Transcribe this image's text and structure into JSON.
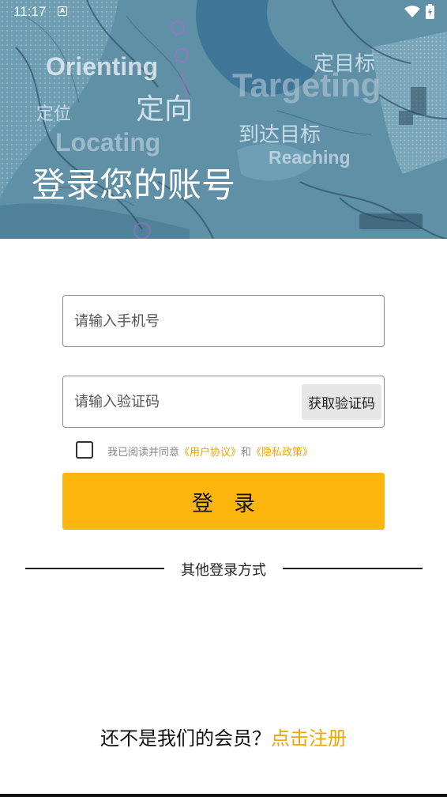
{
  "status_bar": {
    "time": "11:17",
    "notification_icon": "A"
  },
  "hero": {
    "slogans": {
      "orienting": "Orienting",
      "dingwei": "定位",
      "dingxiang": "定向",
      "locating": "Locating",
      "dingmubiao": "定目标",
      "targeting": "Targeting",
      "daoda": "到达目标",
      "reaching": "Reaching"
    },
    "title": "登录您的账号"
  },
  "form": {
    "phone_placeholder": "请输入手机号",
    "phone_value": "",
    "code_placeholder": "请输入验证码",
    "code_value": "",
    "get_code_label": "获取验证码",
    "agree": {
      "checked": false,
      "prefix": "我已阅读并同意",
      "user_agreement": "《用户协议》",
      "and": "和",
      "privacy_policy": "《隐私政策》"
    },
    "login_label": "登录"
  },
  "other_login": {
    "label": "其他登录方式"
  },
  "register": {
    "prompt": "还不是我们的会员？",
    "link": "点击注册"
  },
  "colors": {
    "accent": "#fdb60d",
    "link": "#f0a500",
    "hero_bg": "#5d8fa6"
  }
}
